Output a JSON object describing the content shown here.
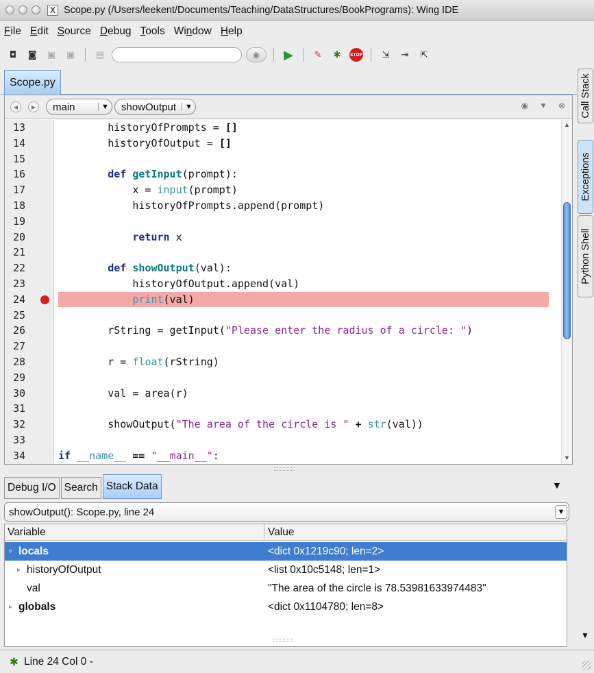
{
  "window": {
    "title": "Scope.py (/Users/leekent/Documents/Teaching/DataStructures/BookPrograms): Wing IDE"
  },
  "menu": [
    {
      "label": "File",
      "underline": "F",
      "rest": "ile"
    },
    {
      "label": "Edit",
      "underline": "E",
      "rest": "dit"
    },
    {
      "label": "Source",
      "underline": "S",
      "rest": "ource"
    },
    {
      "label": "Debug",
      "underline": "D",
      "rest": "ebug"
    },
    {
      "label": "Tools",
      "underline": "T",
      "rest": "ools"
    },
    {
      "label": "Window",
      "pre": "Wi",
      "underline": "n",
      "rest": "dow"
    },
    {
      "label": "Help",
      "underline": "H",
      "rest": "elp"
    }
  ],
  "toolbar": {
    "search_value": ""
  },
  "editor": {
    "tab_label": "Scope.py",
    "scope_combo": "main",
    "function_combo": "showOutput",
    "breakpoint_line": 24,
    "lines": [
      {
        "n": "13",
        "html": "        historyOfPrompts = <span class=\"op\">[]</span>"
      },
      {
        "n": "14",
        "html": "        historyOfOutput = <span class=\"op\">[]</span>"
      },
      {
        "n": "15",
        "html": ""
      },
      {
        "n": "16",
        "html": "        <span class=\"kw\">def</span> <span class=\"fn\">getInput</span>(prompt):"
      },
      {
        "n": "17",
        "html": "            x = <span class=\"bi\">input</span>(prompt)"
      },
      {
        "n": "18",
        "html": "            historyOfPrompts.append(prompt)"
      },
      {
        "n": "19",
        "html": ""
      },
      {
        "n": "20",
        "html": "            <span class=\"kw\">return</span> x"
      },
      {
        "n": "21",
        "html": ""
      },
      {
        "n": "22",
        "html": "        <span class=\"kw\">def</span> <span class=\"fn\">showOutput</span>(val):"
      },
      {
        "n": "23",
        "html": "            historyOfOutput.append(val)"
      },
      {
        "n": "24",
        "html": "            <span class=\"bi\">print</span>(val)"
      },
      {
        "n": "25",
        "html": ""
      },
      {
        "n": "26",
        "html": "        rString = getInput(<span class=\"st\">\"Please enter the radius of a circle: \"</span>)"
      },
      {
        "n": "27",
        "html": ""
      },
      {
        "n": "28",
        "html": "        r = <span class=\"bi\">float</span>(rString)"
      },
      {
        "n": "29",
        "html": ""
      },
      {
        "n": "30",
        "html": "        val = area(r)"
      },
      {
        "n": "31",
        "html": ""
      },
      {
        "n": "32",
        "html": "        showOutput(<span class=\"st\">\"The area of the circle is \"</span> <span class=\"op\">+</span> <span class=\"bi\">str</span>(val))"
      },
      {
        "n": "33",
        "html": ""
      },
      {
        "n": "34",
        "html": "<span class=\"kw\">if</span> <span class=\"bi\">__name__</span> <span class=\"op\">==</span> <span class=\"st\">\"__main__\"</span>:"
      }
    ]
  },
  "side_tabs": [
    "Call Stack",
    "Exceptions",
    "Python Shell"
  ],
  "bottom_panel": {
    "tabs": [
      "Debug I/O",
      "Search",
      "Stack Data"
    ],
    "active_tab": "Stack Data",
    "frame": "showOutput(): Scope.py, line 24",
    "columns": {
      "variable": "Variable",
      "value": "Value"
    },
    "rows": [
      {
        "name": "locals",
        "value": "<dict 0x1219c90; len=2>",
        "expander": "▿"
      },
      {
        "name": "historyOfOutput",
        "value": "<list 0x10c5148; len=1>",
        "expander": "▹"
      },
      {
        "name": "val",
        "value": "\"The area of the circle is 78.53981633974483\"",
        "expander": ""
      },
      {
        "name": "globals",
        "value": "<dict 0x1104780; len=8>",
        "expander": "▹"
      }
    ]
  },
  "status": {
    "text": "Line 24 Col 0 -"
  }
}
